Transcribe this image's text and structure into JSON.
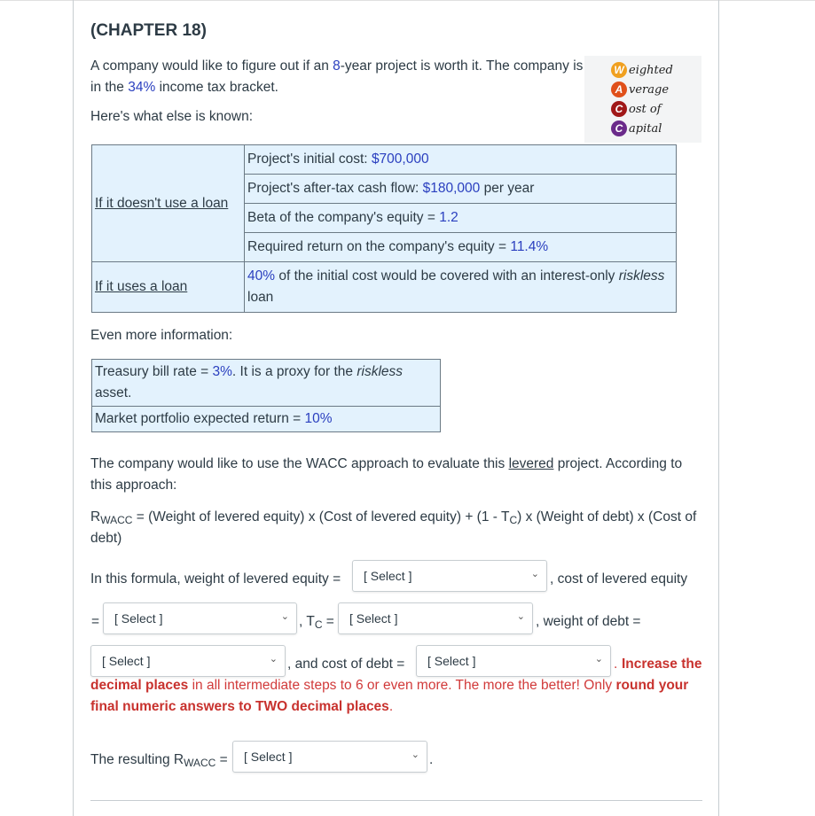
{
  "title": "(CHAPTER 18)",
  "intro": {
    "part1": "A company would like to figure out if an ",
    "years": "8",
    "part2": "-year project is worth it. The company is in the ",
    "tax": "34%",
    "part3": " income tax bracket."
  },
  "known_label": "Here's what else is known:",
  "wacc_image": {
    "letters": [
      "W",
      "A",
      "C",
      "C"
    ],
    "words": [
      "eighted",
      "verage",
      "ost of",
      "apital"
    ],
    "colors": [
      "#f0a020",
      "#e0501a",
      "#a01818",
      "#6a2a8a"
    ]
  },
  "table1": {
    "no_loan_label": "If it doesn't use a loan",
    "loan_label": "If it uses a loan",
    "rows": [
      {
        "text": "Project's initial cost: ",
        "value": "$700,000",
        "suffix": ""
      },
      {
        "text": "Project's after-tax cash flow: ",
        "value": "$180,000",
        "suffix": " per year"
      },
      {
        "text": "Beta of the company's equity = ",
        "value": "1.2",
        "suffix": ""
      },
      {
        "text": "Required return on the company's equity = ",
        "value": "11.4%",
        "suffix": ""
      }
    ],
    "loan_row": {
      "value": "40%",
      "text": " of the initial cost would be covered with an interest-only ",
      "italic": "riskless",
      "suffix": " loan"
    }
  },
  "even_more_label": "Even more information:",
  "table2": {
    "row1": {
      "text": "Treasury bill rate = ",
      "value": "3%",
      "mid": ". It is a proxy for the ",
      "italic": "riskless",
      "suffix": " asset."
    },
    "row2": {
      "text": "Market portfolio expected return = ",
      "value": "10%"
    }
  },
  "approach": {
    "part1": "The company would like to use the WACC approach to evaluate this ",
    "underlined": "levered",
    "part2": " project. According to this approach:"
  },
  "formula": {
    "R": "R",
    "sub": "WACC",
    "part1": " = (Weight of levered equity) x (Cost of levered equity) + (1 - T",
    "tc_sub": "C",
    "part2": ") x (Weight of debt) x (Cost of debt)"
  },
  "questions": {
    "q1_prefix": "In this formula, weight of levered equity =",
    "q1_suffix": ", cost of levered equity",
    "q2_prefix": "=",
    "tc_label": ", T",
    "tc_sub": "C",
    "tc_eq": " =",
    "q4_suffix": ", weight of debt =",
    "q5_suffix": ",  and cost of debt =",
    "instr_1": ". ",
    "instr_b1": "Increase the decimal places",
    "instr_2": " in all intermediate steps to 6 or even more. The more the better! Only ",
    "instr_b2": "round your final numeric answers to TWO decimal places",
    "instr_3": ".",
    "result_prefix": "The resulting R",
    "result_sub": "WACC",
    "result_eq": " =",
    "result_suffix": "."
  },
  "selects": {
    "placeholder": "[ Select ]",
    "weight_equity": "[ Select ]",
    "cost_equity": "[ Select ]",
    "tax_rate": "[ Select ]",
    "weight_debt": "[ Select ]",
    "cost_debt": "[ Select ]",
    "rwacc": "[ Select ]"
  }
}
